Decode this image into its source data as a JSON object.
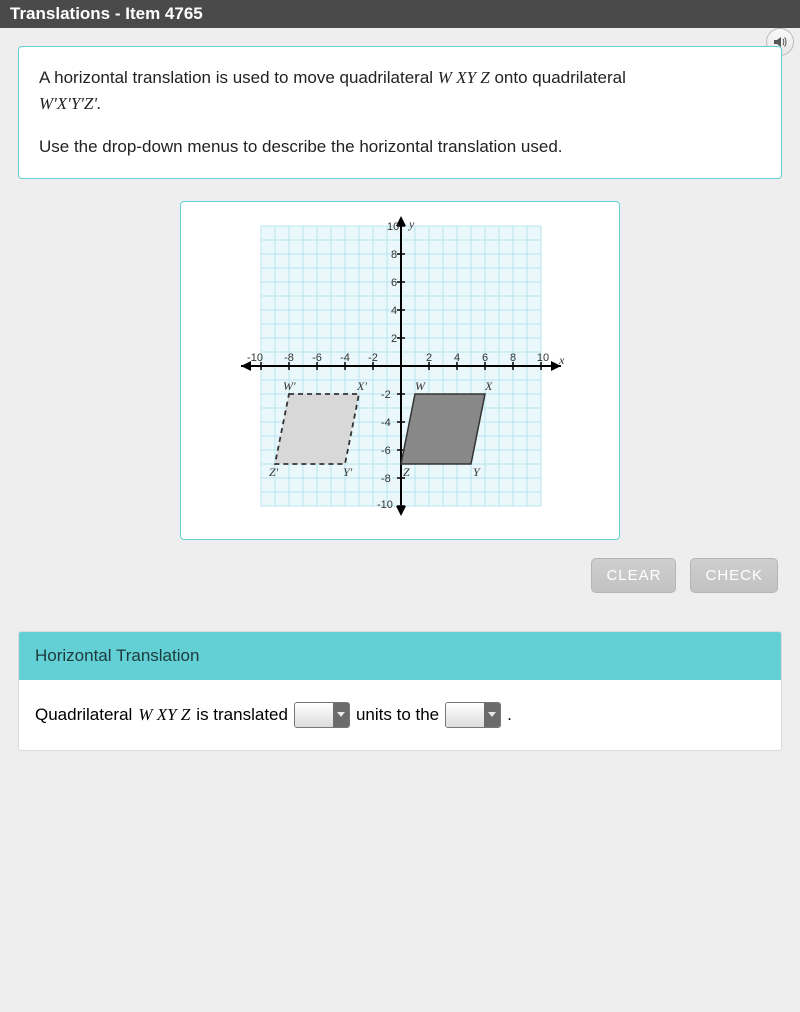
{
  "header": {
    "title": "Translations - Item 4765"
  },
  "prompt": {
    "line1a": "A horizontal translation is used to move quadrilateral ",
    "wxyz": "W XY Z",
    "line1b": " onto quadrilateral ",
    "wxyz_prime": "W'X'Y'Z'.",
    "line2": "Use the drop-down menus to describe the horizontal translation used."
  },
  "graph": {
    "y_label": "y",
    "x_label": "x",
    "y_ticks": [
      "10",
      "8",
      "6",
      "4",
      "2",
      "-2",
      "-4",
      "-6",
      "-8",
      "-10"
    ],
    "x_ticks": [
      "-10",
      "-8",
      "-6",
      "-4",
      "-2",
      "2",
      "4",
      "6",
      "8",
      "10"
    ],
    "labels": {
      "W": "W",
      "X": "X",
      "Y": "Y",
      "Z": "Z",
      "Wp": "W'",
      "Xp": "X'",
      "Yp": "Y'",
      "Zp": "Z'"
    }
  },
  "buttons": {
    "clear": "CLEAR",
    "check": "CHECK"
  },
  "answer": {
    "header": "Horizontal Translation",
    "pre": "Quadrilateral ",
    "wxyz": "W XY Z",
    "mid1": " is translated ",
    "mid2": " units to the ",
    "end": "."
  }
}
